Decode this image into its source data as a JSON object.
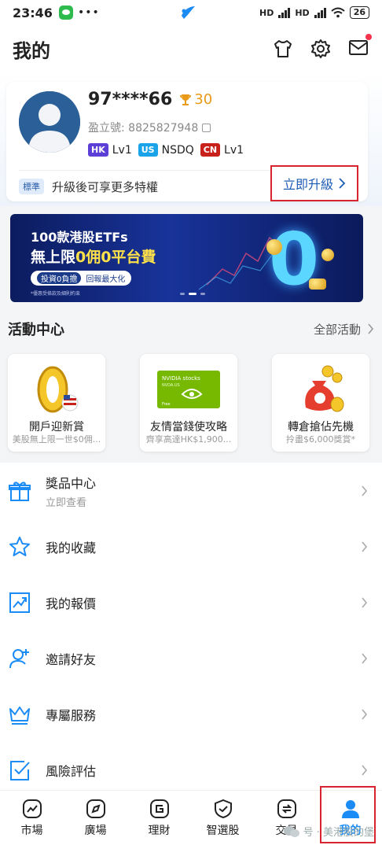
{
  "status_bar": {
    "time": "23:46",
    "dots": "•••",
    "network_a": "HD",
    "network_b": "HD",
    "battery": "26"
  },
  "header": {
    "title": "我的"
  },
  "profile": {
    "username": "97****66",
    "points": "30",
    "account_label": "盈立號: 8825827948",
    "levels": [
      {
        "tag": "HK",
        "label": "Lv1"
      },
      {
        "tag": "US",
        "label": "NSDQ"
      },
      {
        "tag": "CN",
        "label": "Lv1"
      }
    ],
    "badge": "標準",
    "upgrade_text": "升級後可享更多特權",
    "upgrade_button": "立即升級"
  },
  "banner": {
    "title": "100款港股ETFs",
    "main_prefix": "無上限",
    "main_highlight": "0佣0平台費",
    "pill_a": "投資0負擔",
    "pill_b": "回報最大化",
    "fine_print": "*優惠受條款及細則約束"
  },
  "activity": {
    "title": "活動中心",
    "more": "全部活動",
    "cards": [
      {
        "title": "開戶迎新賞",
        "subtitle": "美股無上限一世$0佣..."
      },
      {
        "title": "友情當錢使攻略",
        "subtitle": "齊享高達HK$1,900..."
      },
      {
        "title": "轉倉搶佔先機",
        "subtitle": "拎盡$6,000獎賞*"
      }
    ],
    "nvidia_caption": "NVIDIA stocks",
    "nvidia_sub": "NVDA.US",
    "nvidia_free": "Free"
  },
  "menu": [
    {
      "label": "獎品中心",
      "sub": "立即查看",
      "icon": "gift-icon"
    },
    {
      "label": "我的收藏",
      "sub": "",
      "icon": "star-icon"
    },
    {
      "label": "我的報價",
      "sub": "",
      "icon": "chart-icon"
    },
    {
      "label": "邀請好友",
      "sub": "",
      "icon": "add-user-icon"
    },
    {
      "label": "專屬服務",
      "sub": "",
      "icon": "crown-icon"
    },
    {
      "label": "風險評估",
      "sub": "",
      "icon": "check-icon"
    }
  ],
  "bottom_nav": [
    {
      "label": "市場",
      "icon": "market-icon"
    },
    {
      "label": "廣場",
      "icon": "compass-icon"
    },
    {
      "label": "理財",
      "icon": "wealth-icon"
    },
    {
      "label": "智選股",
      "icon": "shield-icon"
    },
    {
      "label": "交易",
      "icon": "trade-icon"
    },
    {
      "label": "我的",
      "icon": "user-icon",
      "active": true
    }
  ],
  "watermark": "号 · 美港股的堡",
  "colors": {
    "primary": "#1b8bf5",
    "link": "#1d5cb4",
    "highlight": "#d8242e",
    "gold": "#e89a18"
  }
}
